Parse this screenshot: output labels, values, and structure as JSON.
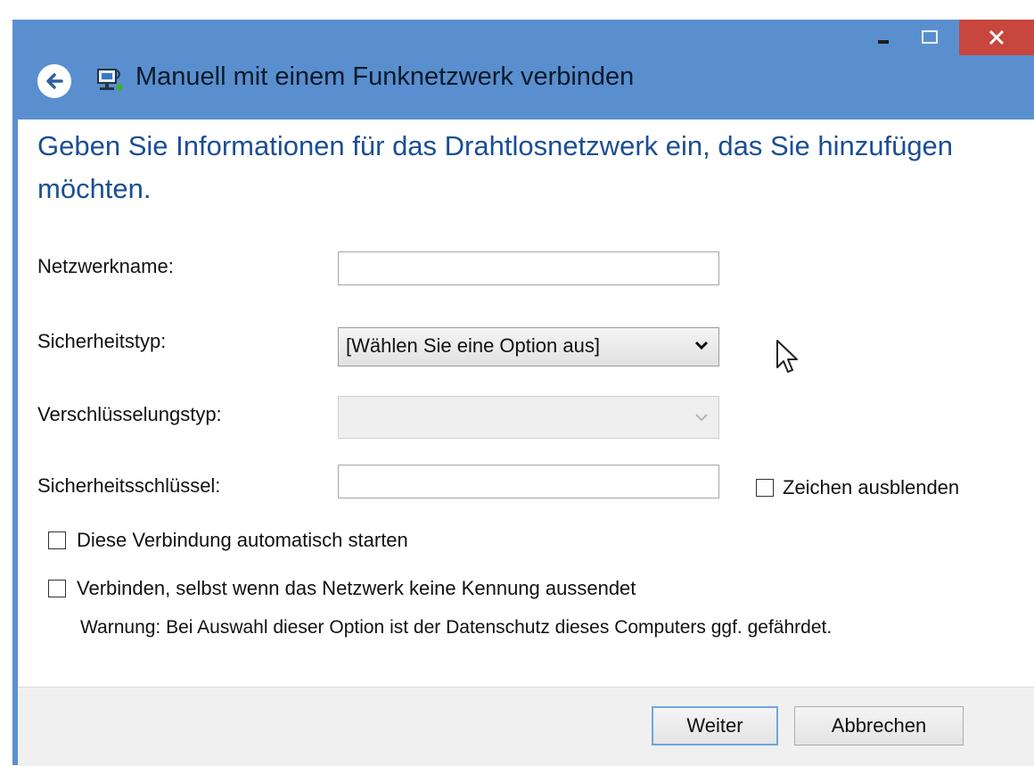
{
  "window": {
    "title": "Manuell mit einem Funknetzwerk verbinden",
    "minimize_symbol": "–",
    "close_symbol": "✕"
  },
  "form": {
    "headline": "Geben Sie Informationen für das Drahtlosnetzwerk ein, das Sie hinzufügen möchten.",
    "network_name_label": "Netzwerkname:",
    "network_name_value": "",
    "security_type_label": "Sicherheitstyp:",
    "security_type_value": "[Wählen Sie eine Option aus]",
    "encryption_type_label": "Verschlüsselungstyp:",
    "encryption_type_value": "",
    "security_key_label": "Sicherheitsschlüssel:",
    "security_key_value": "",
    "hide_characters_label": "Zeichen ausblenden",
    "auto_connect_label": "Diese Verbindung automatisch starten",
    "connect_hidden_label": "Verbinden, selbst wenn das Netzwerk keine Kennung aussendet",
    "warning": "Warnung: Bei Auswahl dieser Option ist der Datenschutz dieses Computers ggf. gefährdet."
  },
  "buttons": {
    "next_label": "Weiter",
    "cancel_label": "Abbrechen"
  },
  "icons": [
    "back-arrow-icon",
    "network-icon",
    "minimize-icon",
    "maximize-icon",
    "close-icon",
    "dropdown-arrow-icon",
    "mouse-cursor-icon"
  ],
  "colors": {
    "titlebar": "#5a8fcf",
    "close_button": "#c7463d",
    "headline": "#1b4f93",
    "default_button_border": "#6fa6dc"
  }
}
